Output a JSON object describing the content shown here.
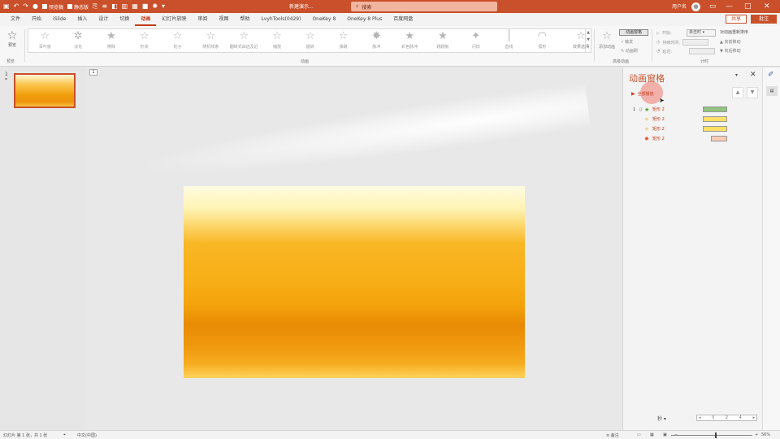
{
  "quick_access": {
    "save_option_1": "预览稿",
    "save_option_2": "静态版"
  },
  "document_title": "新建演示...",
  "search": {
    "placeholder": "搜索"
  },
  "user": "用户名",
  "window_controls": {
    "minimize": "—",
    "restore": "□",
    "close": "✕"
  },
  "tabs": [
    "文件",
    "开始",
    "iSlide",
    "插入",
    "设计",
    "切换",
    "动画",
    "幻灯片放映",
    "审阅",
    "视图",
    "帮助",
    "LvyhTools(0429)",
    "OneKey 8",
    "OneKey 8 Plus",
    "百度网盘"
  ],
  "active_tab": "动画",
  "share_label": "共享",
  "comment_label": "批注",
  "ribbon": {
    "preview_label": "预览",
    "preview_group": "预览",
    "animations_group": "动画",
    "advanced_group": "高级动画",
    "timing_group": "计时",
    "animations": [
      "百叶窗",
      "淡化",
      "擦除",
      "形状",
      "轮子",
      "随机线条",
      "翻转式由远及近",
      "缩放",
      "旋转",
      "弹跳",
      "脉冲",
      "彩色脉冲",
      "跷跷板",
      "闪烁",
      "直线",
      "弧形"
    ],
    "effect_options": "效果选项",
    "add_animation": "添加动画",
    "animation_pane_button": "动画窗格",
    "trigger": "触发",
    "painter": "动画刷",
    "start_label": "开始:",
    "start_value": "单击时",
    "duration_label": "持续时间:",
    "delay_label": "延迟:",
    "reorder_title": "对动画重新排序",
    "move_earlier": "向前移动",
    "move_later": "向后移动"
  },
  "thumbnail": {
    "number": "1",
    "star": "*"
  },
  "pane": {
    "title": "动画窗格",
    "play_all": "全部播放",
    "rows": [
      {
        "num": "1",
        "icon": "star-green-icon",
        "name": "矩形 2",
        "bar_color": "#92c47d"
      },
      {
        "num": "",
        "icon": "star-yellow-icon",
        "name": "矩形 2",
        "bar_color": "#ffe066"
      },
      {
        "num": "",
        "icon": "star-yellow-icon",
        "name": "矩形 2",
        "bar_color": "#ffe066"
      },
      {
        "num": "",
        "icon": "star-red-icon",
        "name": "矩形 2",
        "bar_color": "#f9cbb5"
      }
    ],
    "seconds_label": "秒"
  },
  "status": {
    "slide_info": "幻灯片 第 1 张，共 1 张",
    "language": "中文(中国)",
    "notes": "备注",
    "zoom": "56%"
  }
}
